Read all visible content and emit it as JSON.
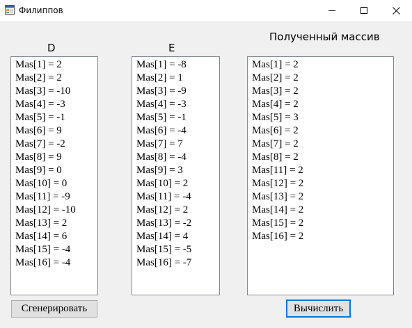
{
  "window": {
    "title": "Филиппов",
    "app_icon": "windows-form-icon",
    "controls": [
      "minimize-icon",
      "maximize-icon",
      "close-icon"
    ]
  },
  "labels": {
    "d": "D",
    "e": "E",
    "result": "Полученный массив"
  },
  "lists": {
    "d": [
      "Mas[1] = 2",
      "Mas[2] = 2",
      "Mas[3] = -10",
      "Mas[4] = -3",
      "Mas[5] = -1",
      "Mas[6] = 9",
      "Mas[7] = -2",
      "Mas[8] = 9",
      "Mas[9] = 0",
      "Mas[10] = 0",
      "Mas[11] = -9",
      "Mas[12] = -10",
      "Mas[13] = 2",
      "Mas[14] = 6",
      "Mas[15] = -4",
      "Mas[16] = -4"
    ],
    "e": [
      "Mas[1] = -8",
      "Mas[2] = 1",
      "Mas[3] = -9",
      "Mas[4] = -3",
      "Mas[5] = -1",
      "Mas[6] = -4",
      "Mas[7] = 7",
      "Mas[8] = -4",
      "Mas[9] = 3",
      "Mas[10] = 2",
      "Mas[11] = -4",
      "Mas[12] = 2",
      "Mas[13] = -2",
      "Mas[14] = 4",
      "Mas[15] = -5",
      "Mas[16] = -7"
    ],
    "result": [
      "Mas[1] = 2",
      "Mas[2] = 2",
      "Mas[3] = 2",
      "Mas[4] = 2",
      "Mas[5] = 3",
      "Mas[6] = 2",
      "Mas[7] = 2",
      "Mas[8] = 2",
      "Mas[11] = 2",
      "Mas[12] = 2",
      "Mas[13] = 2",
      "Mas[14] = 2",
      "Mas[15] = 2",
      "Mas[16] = 2"
    ]
  },
  "buttons": {
    "generate": "Сгенерировать",
    "compute": "Вычислить"
  },
  "colors": {
    "window_bg": "#f0f0f0",
    "list_border": "#828790",
    "default_button_border": "#0078d7",
    "button_bg": "#e1e1e1"
  }
}
